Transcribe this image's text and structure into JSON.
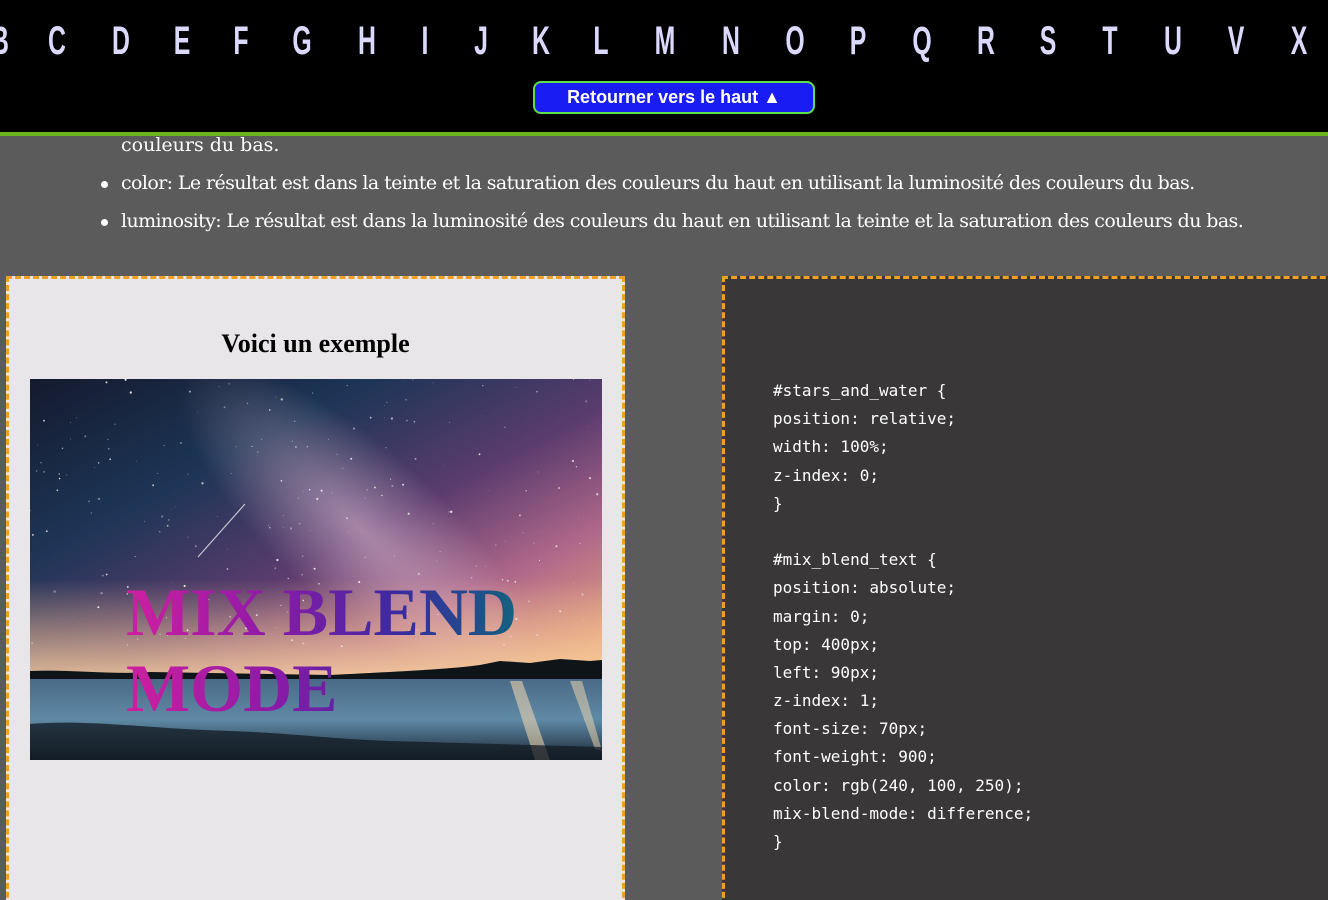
{
  "nav": {
    "letters": [
      "B",
      "C",
      "D",
      "E",
      "F",
      "G",
      "H",
      "I",
      "J",
      "K",
      "L",
      "M",
      "N",
      "O",
      "P",
      "Q",
      "R",
      "S",
      "T",
      "U",
      "V",
      "X"
    ],
    "back_to_top": "Retourner vers le haut ▲"
  },
  "description": {
    "partial_line": "couleurs du bas.",
    "items": [
      "color: Le résultat est dans la teinte et la saturation des couleurs du haut en utilisant la luminosité des couleurs du bas.",
      "luminosity: Le résultat est dans la luminosité des couleurs du haut en utilisant la teinte et la saturation des couleurs du bas."
    ]
  },
  "example": {
    "title": "Voici un exemple",
    "blend_text": "MIX BLEND MODE"
  },
  "code": {
    "lines": [
      "#stars_and_water {",
      "position: relative;",
      "width: 100%;",
      "z-index: 0;",
      "}",
      "",
      "#mix_blend_text {",
      "position: absolute;",
      "margin: 0;",
      "top: 400px;",
      "left: 90px;",
      "z-index: 1;",
      "font-size: 70px;",
      "font-weight: 900;",
      "color: rgb(240, 100, 250);",
      "mix-blend-mode: difference;",
      "}"
    ]
  },
  "colors": {
    "page_background": "#5b5b5b",
    "nav_background": "#000000",
    "nav_border": "#6bb321",
    "letter_color": "#dcd9ff",
    "button_background": "#1a1cf4",
    "button_border": "#5ee04a",
    "panel_border": "#f0a020",
    "example_panel_bg": "#e8e6e8",
    "code_panel_bg": "#393737"
  }
}
